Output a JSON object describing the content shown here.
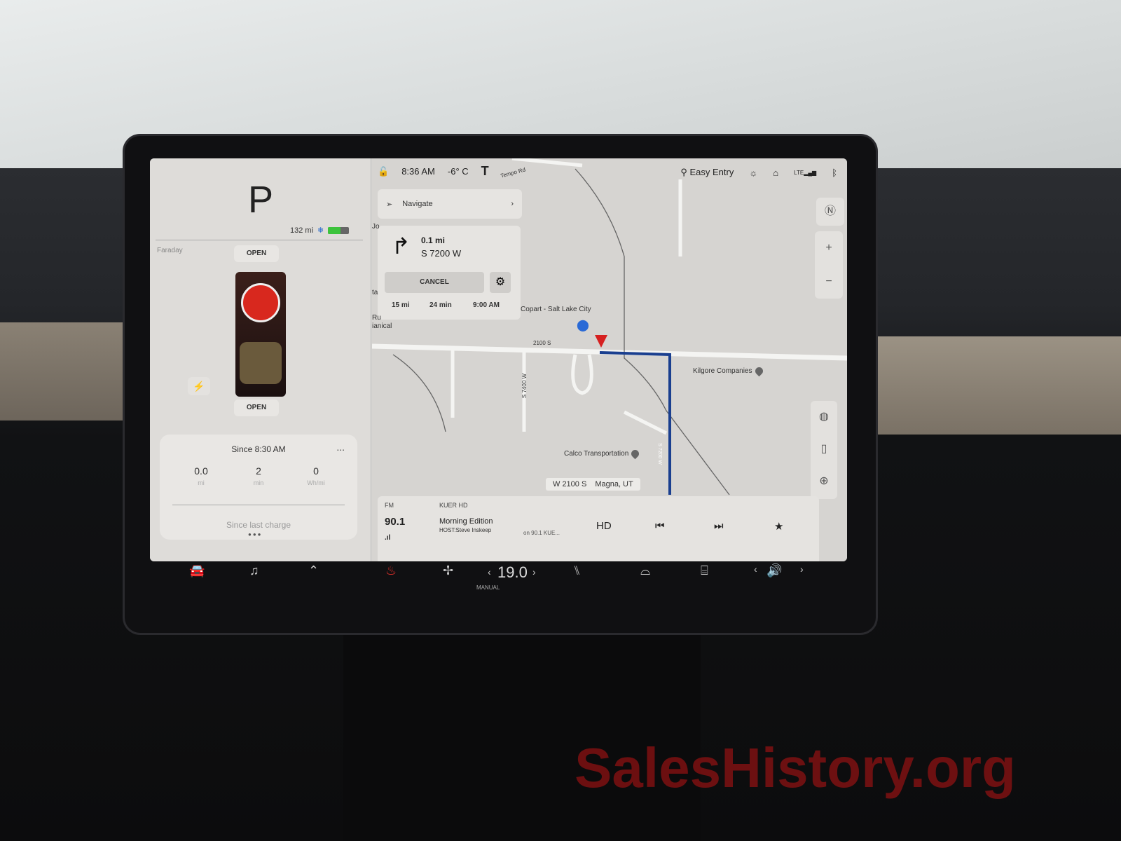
{
  "status": {
    "time": "8:36 AM",
    "temp": "-6° C",
    "profile": "Easy Entry",
    "network": "LTE"
  },
  "left_panel": {
    "gear": "P",
    "range": "132 mi",
    "battery_level_pct": 60,
    "location_label": "Faraday",
    "frunk_label": "OPEN",
    "trunk_label": "OPEN",
    "trip": {
      "title": "Since 8:30 AM",
      "more": "...",
      "stats": [
        {
          "value": "0.0",
          "unit": "mi"
        },
        {
          "value": "2",
          "unit": "min"
        },
        {
          "value": "0",
          "unit": "Wh/mi"
        }
      ],
      "footer": "Since last charge"
    }
  },
  "nav": {
    "navigate_label": "Navigate",
    "turn_distance": "0.1 mi",
    "turn_street": "S 7200 W",
    "cancel_label": "CANCEL",
    "eta": {
      "distance": "15 mi",
      "duration": "24 min",
      "arrival": "9:00 AM"
    }
  },
  "map": {
    "pois": [
      "Copart - Salt Lake City",
      "Kilgore Companies",
      "Calco Transportation"
    ],
    "roads": [
      "Tempo Rd",
      "2100 S",
      "S 7400 W",
      "S 7200 W"
    ],
    "address": {
      "street": "W 2100 S",
      "city": "Magna, UT"
    },
    "partial_labels": [
      "Jo",
      "ta",
      "Ru",
      "ianical"
    ]
  },
  "media": {
    "band": "FM",
    "station": "KUER HD",
    "frequency": "90.1",
    "song": "Morning Edition",
    "host": "HOST:Steve Inskeep",
    "source": "on 90.1 KUE..."
  },
  "climate": {
    "temperature": "19.0",
    "mode": "MANUAL"
  },
  "colors": {
    "route": "#1a3f8f",
    "vehicle_marker": "#d62020",
    "battery": "#3cc33c",
    "seat_heat": "#e0302a"
  },
  "watermark": "SalesHistory.org"
}
